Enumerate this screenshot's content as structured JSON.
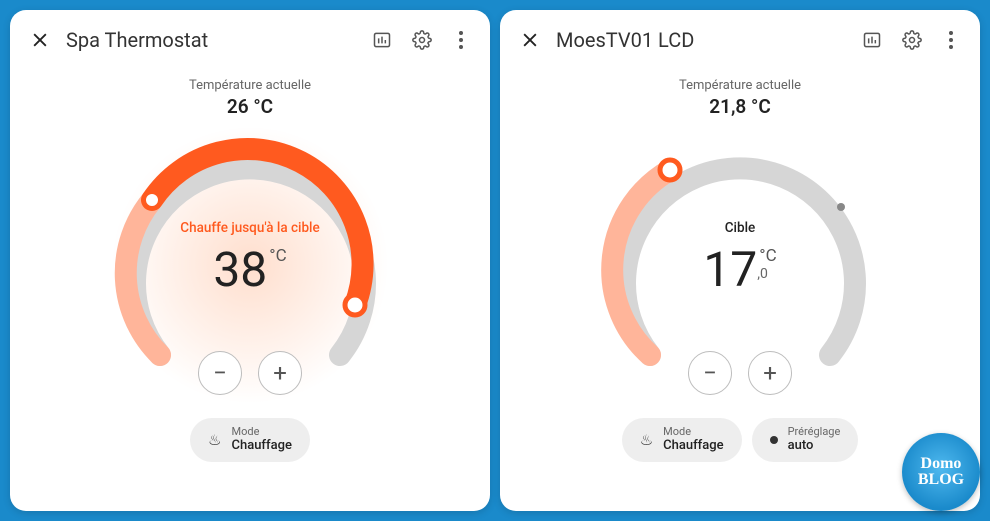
{
  "cards": [
    {
      "id": "spa",
      "title": "Spa Thermostat",
      "current_temp_label": "Température actuelle",
      "current_temp_value": "26 °C",
      "status_text": "Chauffe jusqu'à la cible",
      "status_heating": true,
      "target_value": "38",
      "target_unit": "°C",
      "target_decimal": "",
      "gauge_fill_fraction": 0.92,
      "gauge_color_light": "#ffb59a",
      "gauge_color_heavy": "#ff5a1f",
      "gauge_idle_color": "#d6d6d6",
      "mode_chip": {
        "label": "Mode",
        "value": "Chauffage",
        "icon": "flame"
      },
      "preset_chip": null
    },
    {
      "id": "moes",
      "title": "MoesTV01 LCD",
      "current_temp_label": "Température actuelle",
      "current_temp_value": "21,8 °C",
      "status_text": "Cible",
      "status_heating": false,
      "target_value": "17",
      "target_unit": "°C",
      "target_decimal": ",0",
      "gauge_fill_fraction": 0.3,
      "gauge_color_light": "#ffb59a",
      "gauge_color_heavy": "#ff5a1f",
      "gauge_idle_color": "#d6d6d6",
      "mode_chip": {
        "label": "Mode",
        "value": "Chauffage",
        "icon": "flame"
      },
      "preset_chip": {
        "label": "Préréglage",
        "value": "auto",
        "icon": "dot"
      }
    }
  ],
  "buttons": {
    "minus": "−",
    "plus": "+"
  },
  "watermark": "Domo\nBLOG"
}
